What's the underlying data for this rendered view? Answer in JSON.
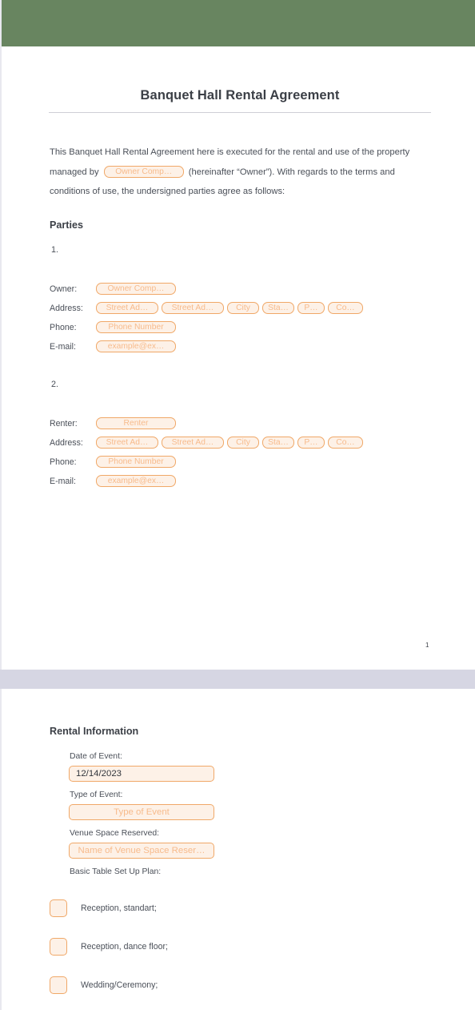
{
  "document": {
    "title": "Banquet Hall Rental Agreement",
    "page_number": "1",
    "intro_paragraph": "This Banquet Hall Rental Agreement here is executed for the rental and use of the property managed by (hereinafter “Owner”). With regards to the terms and conditions of use, the undersigned parties agree as follows:",
    "intro_before": "This Banquet Hall Rental Agreement here is executed for the rental and use of the property managed by",
    "intro_after": "(hereinafter “Owner”). With regards to the terms and conditions of use, the undersigned parties agree as follows:",
    "inline_owner_field": "Owner Comp…"
  },
  "colors": {
    "header_band": "#688560",
    "page_separator": "#d6d6e3",
    "field_border": "#f0a868",
    "field_fill": "#fdf1e7",
    "placeholder_text": "#f7bb8c",
    "body_text": "#4a4f58",
    "heading_text": "#3b3f46"
  },
  "parties": {
    "heading": "Parties",
    "items": [
      {
        "number": "1.",
        "rows": [
          {
            "label": "Owner:",
            "fields": [
              "Owner Comp…"
            ]
          },
          {
            "label": "Address:",
            "fields": [
              "Street Ad…",
              "Street Ad…",
              "City",
              "Sta…",
              "P…",
              "Co…"
            ]
          },
          {
            "label": "Phone:",
            "fields": [
              "Phone Number"
            ]
          },
          {
            "label": "E-mail:",
            "fields": [
              "example@ex…"
            ]
          }
        ]
      },
      {
        "number": "2.",
        "rows": [
          {
            "label": "Renter:",
            "fields": [
              "Renter"
            ]
          },
          {
            "label": "Address:",
            "fields": [
              "Street Ad…",
              "Street Ad…",
              "City",
              "Sta…",
              "P…",
              "Co…"
            ]
          },
          {
            "label": "Phone:",
            "fields": [
              "Phone Number"
            ]
          },
          {
            "label": "E-mail:",
            "fields": [
              "example@ex…"
            ]
          }
        ]
      }
    ]
  },
  "rental_information": {
    "heading": "Rental Information",
    "fields": [
      {
        "label": "Date of Event:",
        "value": "12/14/2023",
        "filled": true
      },
      {
        "label": "Type of Event:",
        "value": "Type of Event",
        "filled": false
      },
      {
        "label": "Venue Space Reserved:",
        "value": "Name of Venue Space Reser…",
        "filled": false
      }
    ],
    "setup_plan_label": "Basic Table Set Up Plan:",
    "setup_options": [
      "Reception, standart;",
      "Reception, dance floor;",
      "Wedding/Ceremony;"
    ]
  }
}
